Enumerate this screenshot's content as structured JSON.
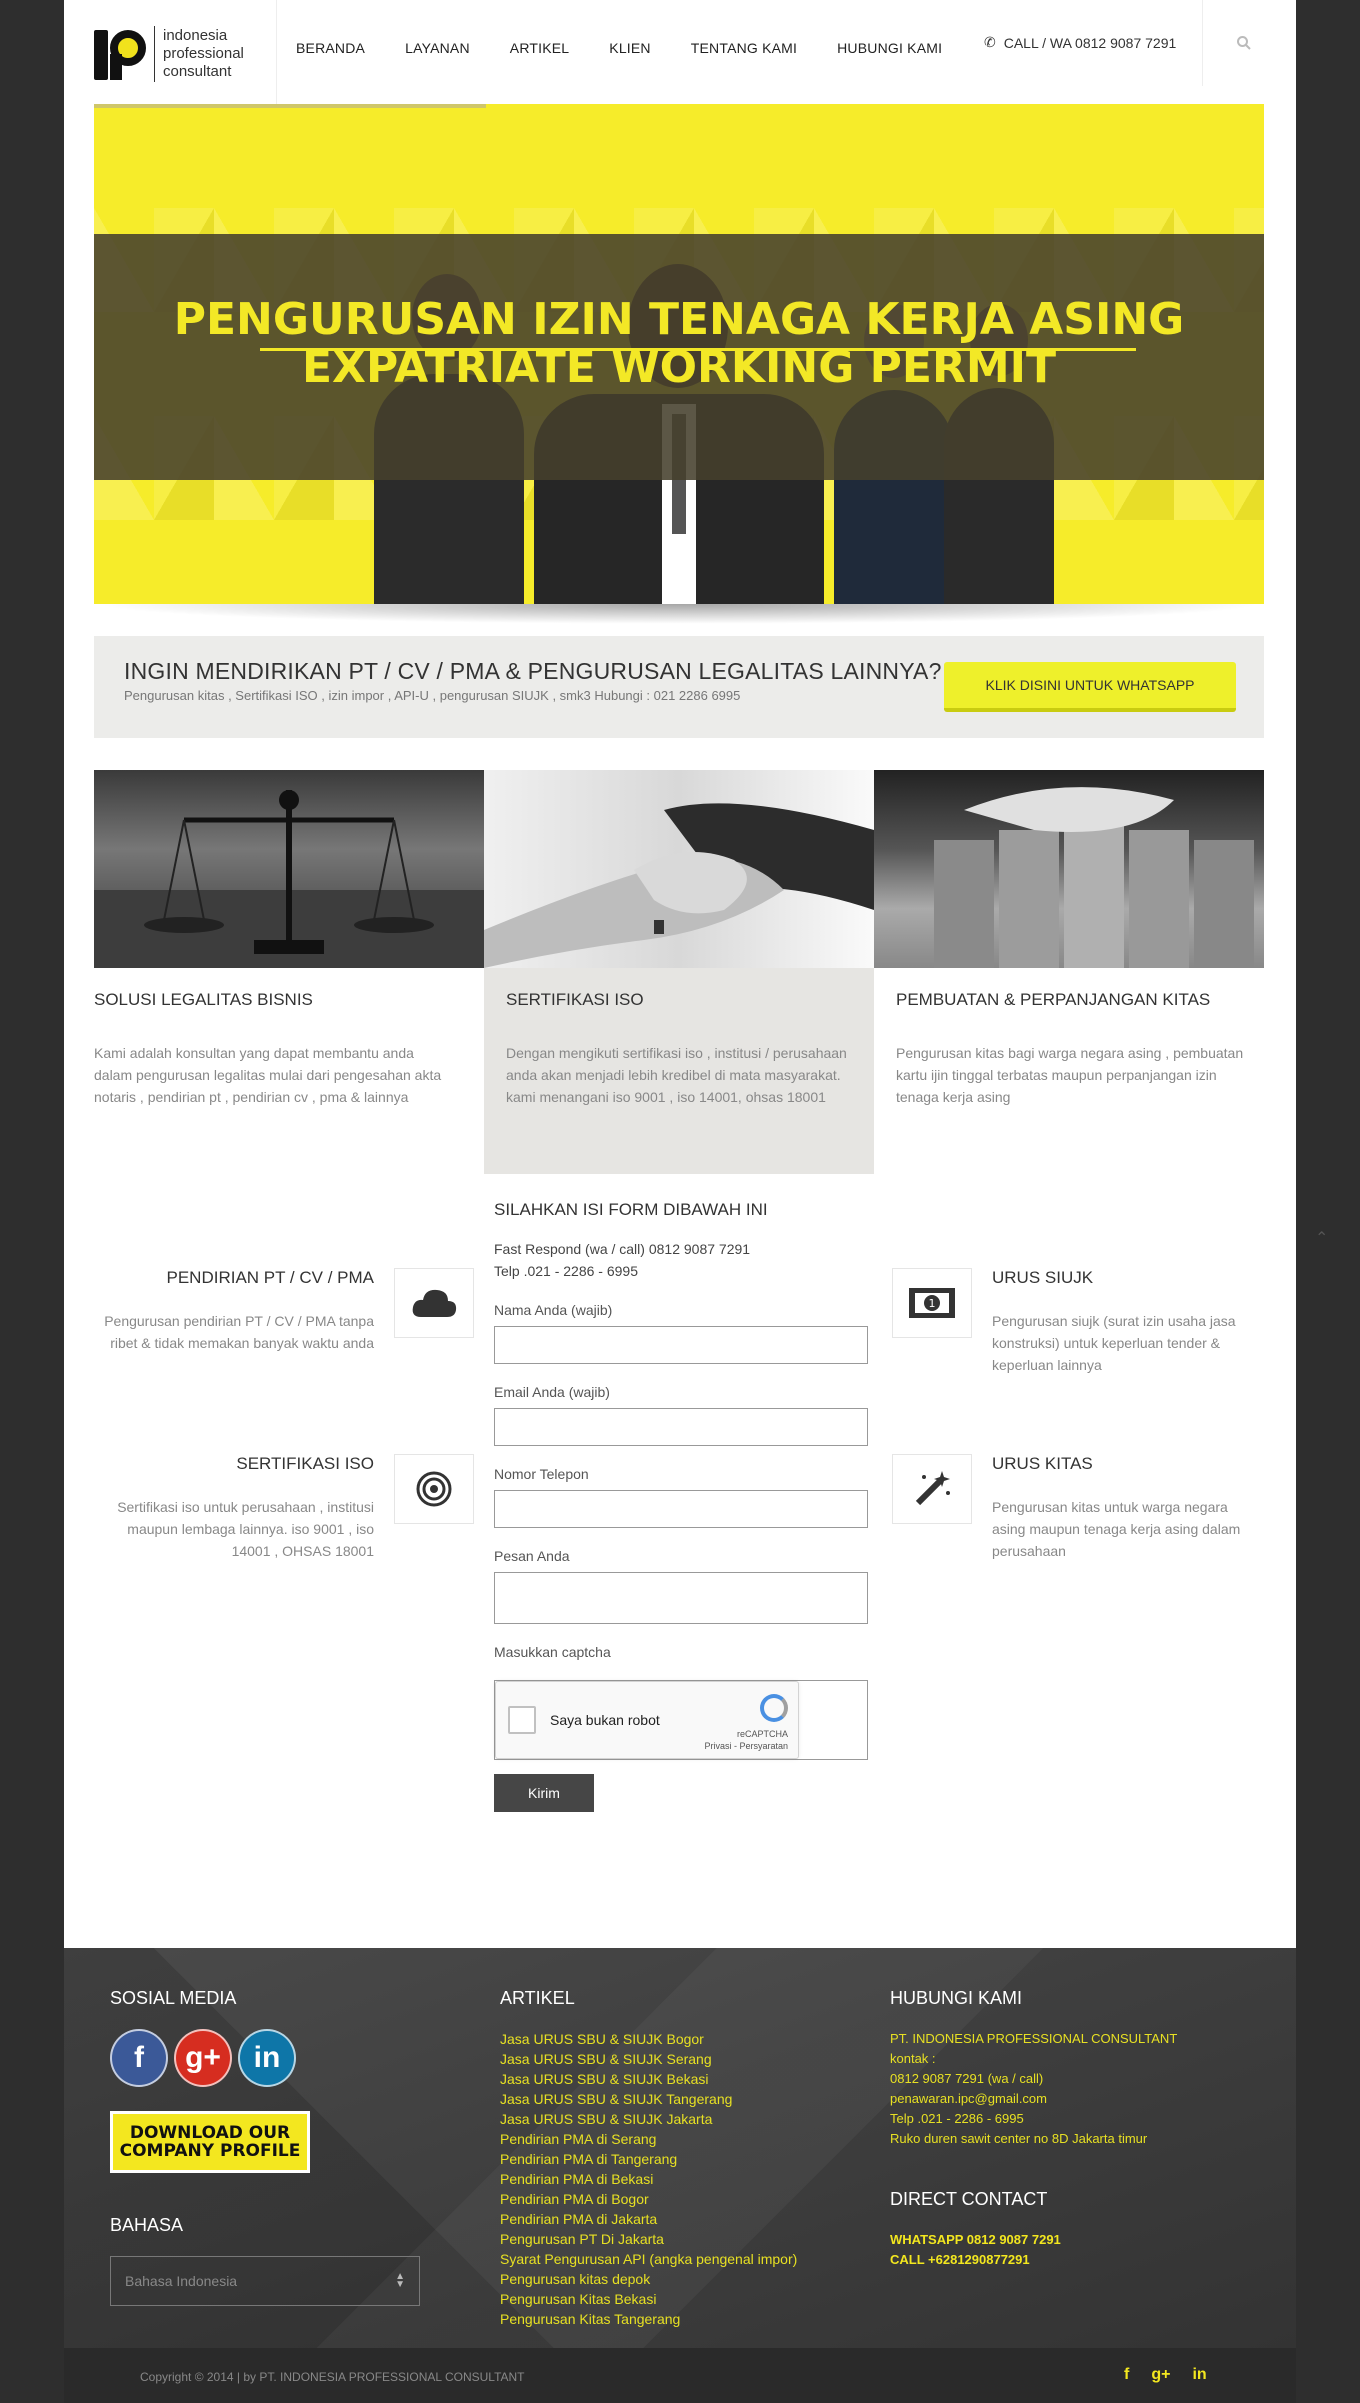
{
  "header": {
    "logo_lines": [
      "indonesia",
      "professional",
      "consultant"
    ],
    "nav": [
      "BERANDA",
      "LAYANAN",
      "ARTIKEL",
      "KLIEN",
      "TENTANG KAMI",
      "HUBUNGI KAMI"
    ],
    "call": "CALL / WA 0812 9087 7291",
    "phone_icon": "phone-icon",
    "search_icon": "search-icon"
  },
  "hero": {
    "title1": "PENGURUSAN IZIN TENAGA KERJA ASING",
    "title2": "EXPATRIATE WORKING PERMIT",
    "accent": "#f3e826"
  },
  "cta": {
    "title": "INGIN MENDIRIKAN PT / CV / PMA & PENGURUSAN LEGALITAS LAINNYA?",
    "subtitle": "Pengurusan kitas , Sertifikasi ISO , izin impor , API-U , pengurusan SIUJK , smk3 Hubungi : 021 2286 6995",
    "button": "KLIK DISINI UNTUK WHATSAPP"
  },
  "services": [
    {
      "title": "SOLUSI LEGALITAS BISNIS",
      "text": "Kami adalah konsultan yang dapat membantu anda dalam pengurusan legalitas mulai dari pengesahan akta notaris , pendirian pt , pendirian cv , pma & lainnya"
    },
    {
      "title": "SERTIFIKASI ISO",
      "text": "Dengan mengikuti sertifikasi iso , institusi / perusahaan anda akan menjadi lebih kredibel di mata masyarakat. kami menangani iso 9001 , iso 14001, ohsas 18001"
    },
    {
      "title": "PEMBUATAN & PERPANJANGAN KITAS",
      "text": "Pengurusan kitas bagi warga negara asing , pembuatan kartu ijin tinggal terbatas maupun perpanjangan izin tenaga kerja asing"
    }
  ],
  "features": {
    "left": [
      {
        "title": "PENDIRIAN PT / CV / PMA",
        "text": "Pengurusan pendirian PT / CV / PMA tanpa ribet & tidak memakan banyak waktu anda",
        "icon": "cloud-icon"
      },
      {
        "title": "SERTIFIKASI ISO",
        "text": "Sertifikasi iso untuk perusahaan , institusi maupun lembaga lainnya. iso 9001 , iso 14001 , OHSAS 18001",
        "icon": "target-icon"
      }
    ],
    "right": [
      {
        "title": "URUS SIUJK",
        "text": "Pengurusan siujk (surat izin usaha jasa konstruksi) untuk keperluan tender & keperluan lainnya",
        "icon": "money-icon"
      },
      {
        "title": "URUS KITAS",
        "text": "Pengurusan kitas untuk warga negara asing maupun tenaga kerja asing dalam perusahaan",
        "icon": "magic-wand-icon"
      }
    ]
  },
  "form": {
    "title": "SILAHKAN ISI FORM DIBAWAH INI",
    "line1": "Fast Respond (wa / call) 0812 9087 7291",
    "line2": "Telp .021 - 2286 - 6995",
    "name_label": "Nama Anda (wajib)",
    "email_label": "Email Anda (wajib)",
    "phone_label": "Nomor Telepon",
    "message_label": "Pesan Anda",
    "captcha_label": "Masukkan captcha",
    "captcha_text": "Saya bukan robot",
    "captcha_brand": "reCAPTCHA",
    "captcha_links": "Privasi - Persyaratan",
    "submit": "Kirim"
  },
  "footer": {
    "social_title": "SOSIAL MEDIA",
    "download_line1": "DOWNLOAD OUR",
    "download_line2": "COMPANY PROFILE",
    "bahasa_title": "BAHASA",
    "bahasa_value": "Bahasa Indonesia",
    "artikel_title": "ARTIKEL",
    "artikel": [
      "Jasa URUS SBU & SIUJK Bogor",
      "Jasa URUS SBU & SIUJK Serang",
      "Jasa URUS SBU & SIUJK Bekasi",
      "Jasa URUS SBU & SIUJK Tangerang",
      "Jasa URUS SBU & SIUJK Jakarta",
      "Pendirian PMA di Serang",
      "Pendirian PMA di Tangerang",
      "Pendirian PMA di Bekasi",
      "Pendirian PMA di Bogor",
      "Pendirian PMA di Jakarta",
      "Pengurusan PT Di Jakarta",
      "Syarat Pengurusan API (angka pengenal impor)",
      "Pengurusan kitas depok",
      "Pengurusan Kitas Bekasi",
      "Pengurusan Kitas Tangerang"
    ],
    "contact_title": "HUBUNGI KAMI",
    "contact": [
      "PT. INDONESIA PROFESSIONAL CONSULTANT",
      "kontak :",
      "0812 9087 7291 (wa / call)",
      "penawaran.ipc@gmail.com",
      "Telp .021 - 2286 - 6995",
      "Ruko duren sawit center no 8D Jakarta timur"
    ],
    "direct_title": "DIRECT CONTACT",
    "direct": [
      "WHATSAPP 0812 9087 7291",
      "CALL +6281290877291"
    ],
    "copyright": "Copyright © 2014 | by PT. INDONESIA PROFESSIONAL CONSULTANT",
    "link_color": "#e7e023"
  }
}
